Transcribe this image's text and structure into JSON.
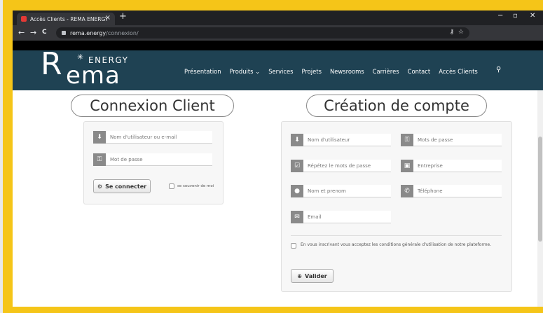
{
  "browser": {
    "tab_title": "Accès Clients - REMA ENERGY",
    "tab_close": "×",
    "new_tab": "+",
    "url_domain": "rema.energy",
    "url_path": "/connexion/",
    "back": "←",
    "forward": "→",
    "reload": "C",
    "minimize": "−",
    "restore": "▫",
    "close": "✕",
    "key_icon": "⚷",
    "star_icon": "☆"
  },
  "logo": {
    "letter": "R",
    "rest": "ema",
    "energy": "ENERGY",
    "star": "✳"
  },
  "nav": {
    "items": [
      "Présentation",
      "Produits ⌄",
      "Services",
      "Projets",
      "Newsrooms",
      "Carrières",
      "Contact",
      "Accès Clients"
    ],
    "search_icon": "⚲"
  },
  "login": {
    "title": "Connexion Client",
    "username_placeholder": "Nom d'utilisateur ou e-mail",
    "password_placeholder": "Mot de passe",
    "submit_label": "Se connecter",
    "remember_label": "se souvenir de moi"
  },
  "signup": {
    "title": "Création de compte",
    "username": "Nom d'utilisateur",
    "password": "Mots de passe",
    "repeat_password": "Répétez le mots de passe",
    "company": "Entreprise",
    "fullname": "Nom et prenom",
    "phone": "Téléphone",
    "email": "Email",
    "conditions": "En vous inscrivant vous acceptez les conditions générale d'utilisation de notre plateforme.",
    "submit_label": "Valider"
  },
  "icons": {
    "user": "⬇",
    "key": "⚿",
    "gear": "⚙",
    "check": "☑",
    "briefcase": "▣",
    "person": "●",
    "phone": "✆",
    "envelope": "✉",
    "adduser": "⊕"
  },
  "colors": {
    "accent_frame": "#f5c518",
    "header": "#1f4253"
  }
}
